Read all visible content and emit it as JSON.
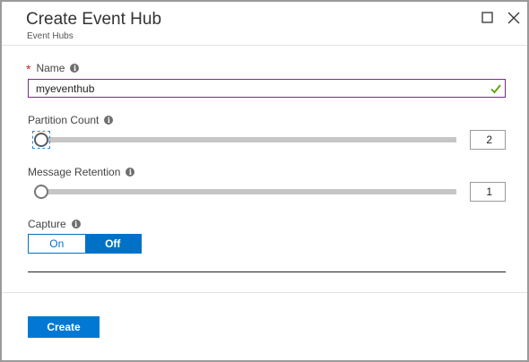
{
  "blade": {
    "title": "Create Event Hub",
    "subtitle": "Event Hubs",
    "maximize_icon": "square-icon",
    "close_icon": "close-icon"
  },
  "form": {
    "name": {
      "required_marker": "*",
      "label": "Name",
      "value": "myeventhub",
      "valid_icon": "checkmark-icon",
      "valid_color": "#57a300"
    },
    "partition_count": {
      "label": "Partition Count",
      "value": "2"
    },
    "message_retention": {
      "label": "Message Retention",
      "value": "1"
    },
    "capture": {
      "label": "Capture",
      "options": [
        "On",
        "Off"
      ],
      "selected": "Off"
    }
  },
  "footer": {
    "create_label": "Create"
  },
  "colors": {
    "accent": "#0078d4",
    "focus_border": "#7a2a88",
    "required": "#c1272d"
  }
}
